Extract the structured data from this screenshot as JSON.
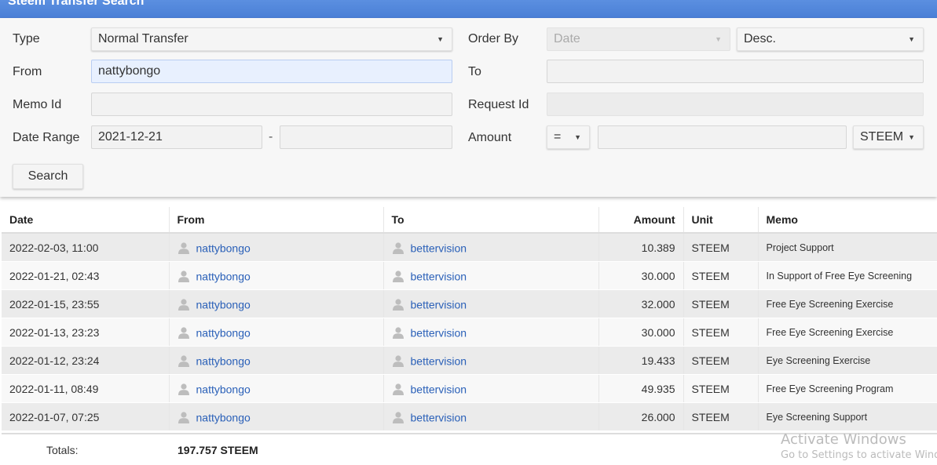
{
  "title": "Steem Transfer Search",
  "form": {
    "type_label": "Type",
    "type_value": "Normal Transfer",
    "order_label": "Order By",
    "order_value": "Date",
    "order_dir": "Desc.",
    "from_label": "From",
    "from_value": "nattybongo",
    "to_label": "To",
    "to_value": "",
    "memo_id_label": "Memo Id",
    "memo_id_value": "",
    "request_id_label": "Request Id",
    "request_id_value": "",
    "date_range_label": "Date Range",
    "date_from": "2021-12-21",
    "date_sep": "-",
    "date_to": "",
    "amount_label": "Amount",
    "amount_op": "=",
    "amount_value": "",
    "unit": "STEEM",
    "search_label": "Search"
  },
  "table": {
    "headers": {
      "date": "Date",
      "from": "From",
      "to": "To",
      "amount": "Amount",
      "unit": "Unit",
      "memo": "Memo"
    },
    "rows": [
      {
        "date": "2022-02-03, 11:00",
        "from": "nattybongo",
        "to": "bettervision",
        "amount": "10.389",
        "unit": "STEEM",
        "memo": "Project Support"
      },
      {
        "date": "2022-01-21, 02:43",
        "from": "nattybongo",
        "to": "bettervision",
        "amount": "30.000",
        "unit": "STEEM",
        "memo": "In Support of Free Eye Screening"
      },
      {
        "date": "2022-01-15, 23:55",
        "from": "nattybongo",
        "to": "bettervision",
        "amount": "32.000",
        "unit": "STEEM",
        "memo": "Free Eye Screening Exercise"
      },
      {
        "date": "2022-01-13, 23:23",
        "from": "nattybongo",
        "to": "bettervision",
        "amount": "30.000",
        "unit": "STEEM",
        "memo": "Free Eye Screening Exercise"
      },
      {
        "date": "2022-01-12, 23:24",
        "from": "nattybongo",
        "to": "bettervision",
        "amount": "19.433",
        "unit": "STEEM",
        "memo": "Eye Screening Exercise"
      },
      {
        "date": "2022-01-11, 08:49",
        "from": "nattybongo",
        "to": "bettervision",
        "amount": "49.935",
        "unit": "STEEM",
        "memo": "Free Eye Screening Program"
      },
      {
        "date": "2022-01-07, 07:25",
        "from": "nattybongo",
        "to": "bettervision",
        "amount": "26.000",
        "unit": "STEEM",
        "memo": "Eye Screening Support"
      }
    ],
    "totals_label": "Totals:",
    "totals_value": "197.757 STEEM"
  },
  "watermark": {
    "line1": "Activate Windows",
    "line2": "Go to Settings to activate Windows."
  },
  "icons": {
    "dropdown": "caret-down-icon",
    "user": "person-icon"
  },
  "colors": {
    "titlebar": "#4a7fd6",
    "link": "#2a60b8",
    "focus_field": "#e8f0fe"
  }
}
